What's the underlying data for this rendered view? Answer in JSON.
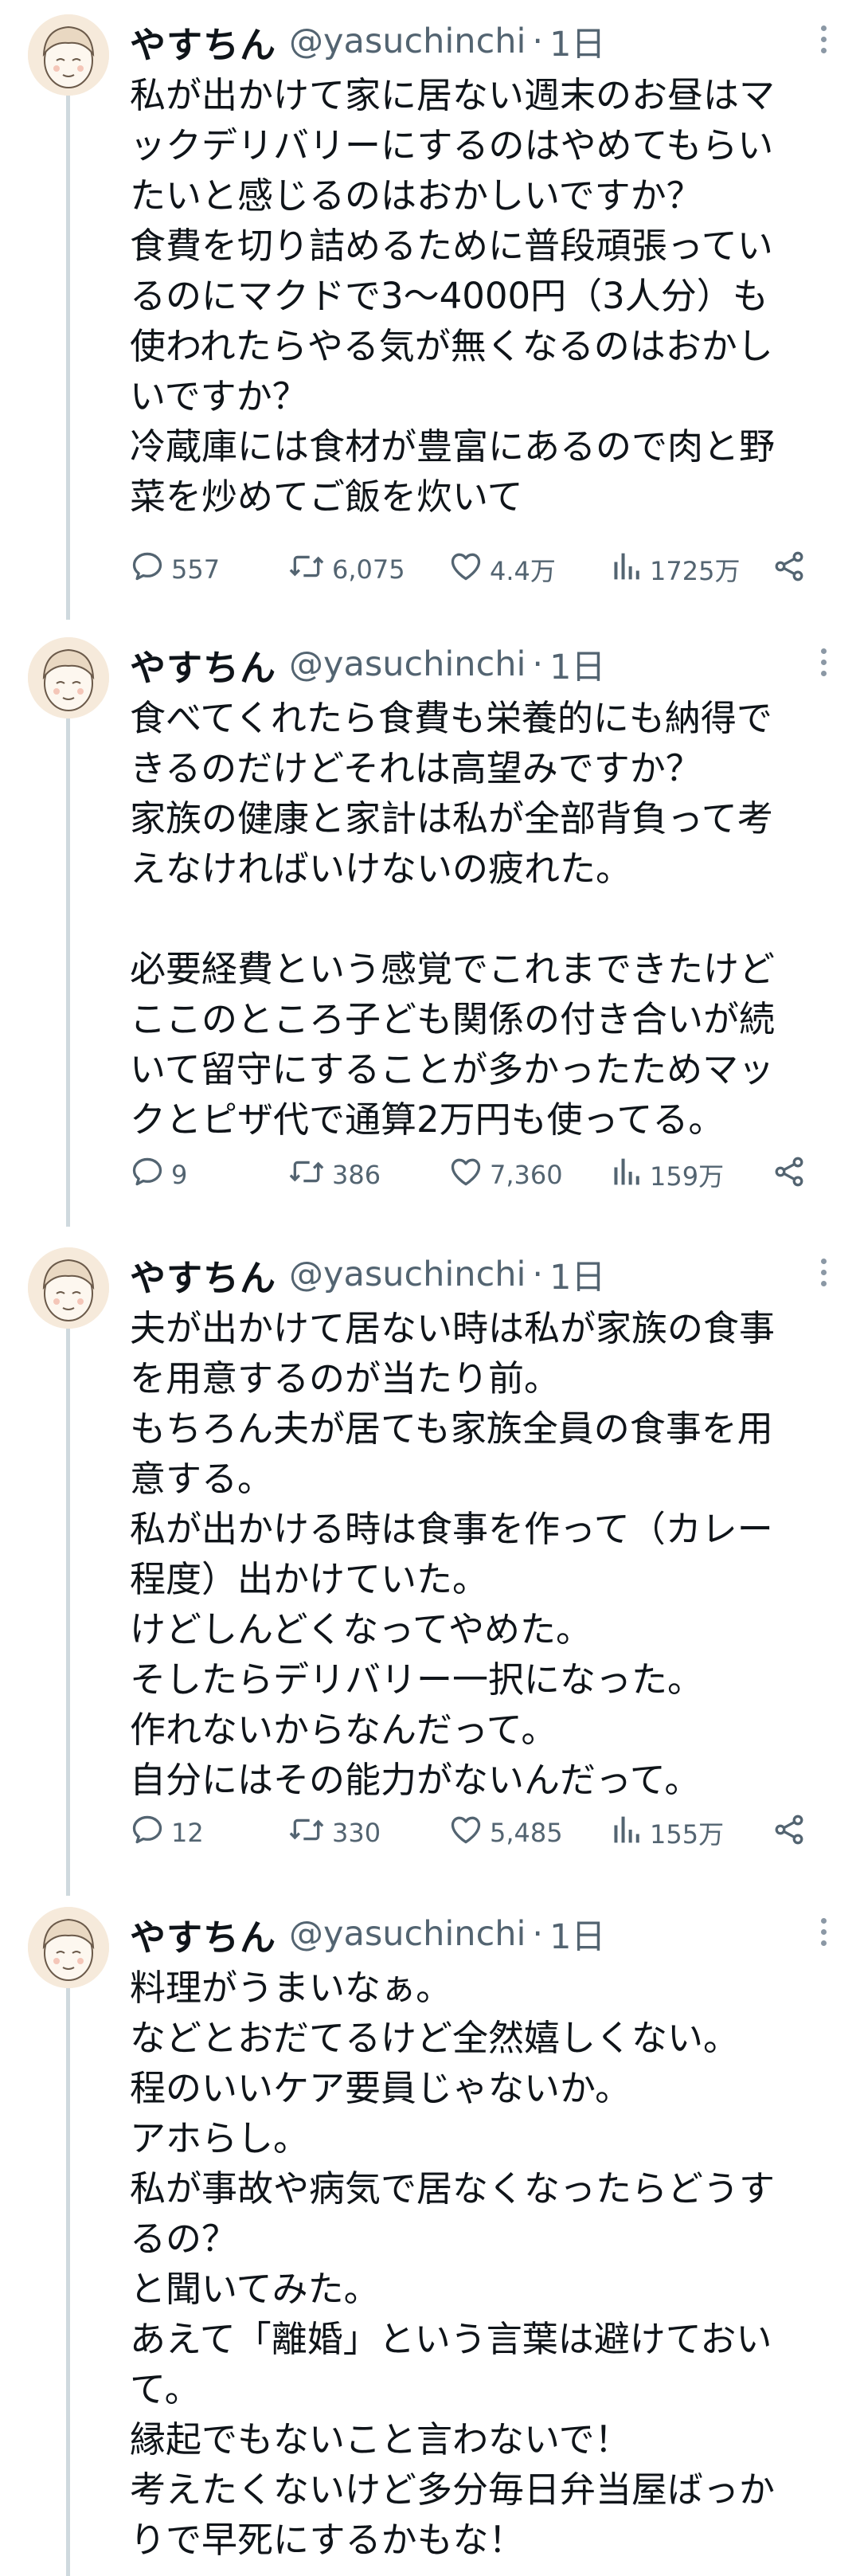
{
  "tweets": [
    {
      "name": "やすちん",
      "handle": "@yasuchinchi",
      "separator": "·",
      "time": "1日",
      "lines": [
        "私が出かけて家に居ない週末のお昼はマ",
        "ックデリバリーにするのはやめてもらい",
        "たいと感じるのはおかしいですか？",
        "食費を切り詰めるために普段頑張ってい",
        "るのにマクドで3〜4000円（3人分）も",
        "使われたらやる気が無くなるのはおかし",
        "いですか？",
        "冷蔵庫には食材が豊富にあるので肉と野",
        "菜を炒めてご飯を炊いて"
      ],
      "stats": {
        "replies": "557",
        "retweets": "6,075",
        "likes": "4.4万",
        "views": "1725万"
      }
    },
    {
      "name": "やすちん",
      "handle": "@yasuchinchi",
      "separator": "·",
      "time": "1日",
      "lines": [
        "食べてくれたら食費も栄養的にも納得で",
        "きるのだけどそれは高望みですか？",
        "家族の健康と家計は私が全部背負って考",
        "えなければいけないの疲れた。",
        "",
        "必要経費という感覚でこれまできたけど",
        "ここのところ子ども関係の付き合いが続",
        "いて留守にすることが多かったためマッ",
        "クとピザ代で通算2万円も使ってる。"
      ],
      "stats": {
        "replies": "9",
        "retweets": "386",
        "likes": "7,360",
        "views": "159万"
      }
    },
    {
      "name": "やすちん",
      "handle": "@yasuchinchi",
      "separator": "·",
      "time": "1日",
      "lines": [
        "夫が出かけて居ない時は私が家族の食事",
        "を用意するのが当たり前。",
        "もちろん夫が居ても家族全員の食事を用",
        "意する。",
        "私が出かける時は食事を作って（カレー",
        "程度）出かけていた。",
        "けどしんどくなってやめた。",
        "そしたらデリバリー一択になった。",
        "作れないからなんだって。",
        "自分にはその能力がないんだって。"
      ],
      "stats": {
        "replies": "12",
        "retweets": "330",
        "likes": "5,485",
        "views": "155万"
      }
    },
    {
      "name": "やすちん",
      "handle": "@yasuchinchi",
      "separator": "·",
      "time": "1日",
      "lines": [
        "料理がうまいなぁ。",
        "などとおだてるけど全然嬉しくない。",
        "程のいいケア要員じゃないか。",
        "アホらし。",
        "私が事故や病気で居なくなったらどうす",
        "るの？",
        "と聞いてみた。",
        "あえて「離婚」という言葉は避けておい",
        "て。",
        "縁起でもないこと言わないで！",
        "考えたくないけど多分毎日弁当屋ばっか",
        "りで早死にするかもな！"
      ],
      "stats": null
    }
  ],
  "icons": [
    "avatar",
    "more-icon",
    "reply-icon",
    "retweet-icon",
    "like-icon",
    "views-icon",
    "share-icon"
  ],
  "colors": {
    "text": "#0f1419",
    "secondary": "#536471",
    "thread_line": "#cfd9de"
  }
}
